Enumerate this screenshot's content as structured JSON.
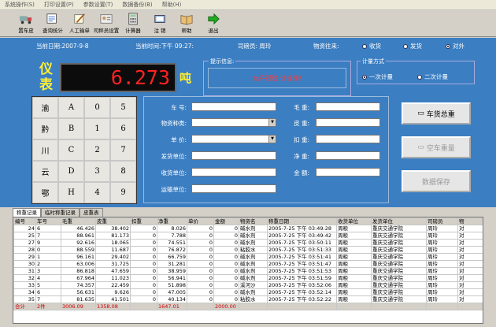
{
  "menu": [
    "系统操作(S)",
    "打印设置(P)",
    "参数设置(T)",
    "数据备份(B)",
    "帮助(H)"
  ],
  "toolbar": [
    {
      "label": "置车皮",
      "icon": "truck-icon"
    },
    {
      "label": "查询统计",
      "icon": "search-stats-icon"
    },
    {
      "label": "人工输单",
      "icon": "manual-entry-icon"
    },
    {
      "label": "司秤员设置",
      "icon": "operator-icon"
    },
    {
      "label": "计算器",
      "icon": "calculator-icon"
    },
    {
      "label": "注 销",
      "icon": "logout-icon"
    },
    {
      "label": "帮助",
      "icon": "help-book-icon"
    },
    {
      "label": "退出",
      "icon": "exit-arrow-icon"
    }
  ],
  "status": {
    "date": "当前日期:2007-9-8",
    "time": "当前时间:下午 09:27:",
    "operator": "司磅员: 周玲",
    "direction_label": "物资往来:",
    "options": [
      "收货",
      "发货",
      "对外"
    ],
    "selected": 2
  },
  "meter": {
    "label": "仪表",
    "value": "6.273",
    "unit": "吨"
  },
  "hint": {
    "title": "提示信息:",
    "text": "允许过磅,请操作!"
  },
  "calc": {
    "title": "计量方式",
    "options": [
      "一次计量",
      "二次计量"
    ],
    "selected": 0
  },
  "keypad": [
    "渝",
    "A",
    "0",
    "5",
    "黔",
    "B",
    "1",
    "6",
    "川",
    "C",
    "2",
    "7",
    "云",
    "D",
    "3",
    "8",
    "鄂",
    "H",
    "4",
    "9"
  ],
  "form_left": [
    {
      "label": "车 号:",
      "dropdown": false
    },
    {
      "label": "物资种类:",
      "dropdown": true
    },
    {
      "label": "单 价:",
      "dropdown": true
    },
    {
      "label": "发货单位:",
      "dropdown": false
    },
    {
      "label": "收货单位:",
      "dropdown": false
    },
    {
      "label": "运输单位:",
      "dropdown": false
    }
  ],
  "form_right": [
    "毛 重:",
    "皮 重:",
    "扣 重:",
    "净 重:",
    "金 额:"
  ],
  "buttons": [
    {
      "label": "车货总重",
      "enabled": true
    },
    {
      "label": "空车重量",
      "enabled": false
    },
    {
      "label": "数据保存",
      "enabled": false
    }
  ],
  "tabs": [
    "称重记录",
    "临时称重记录",
    "皮重表"
  ],
  "grid": {
    "headers": [
      "编号",
      "车号",
      "毛重",
      "皮重",
      "扣重",
      "净重",
      "单价",
      "金额",
      "物资名",
      "称重日期",
      "收货单位",
      "发货单位",
      "司磅员",
      "物"
    ],
    "rows": [
      [
        "24",
        "6",
        "46.426",
        "38.402",
        "0",
        "8.026",
        "0",
        "0",
        "碱水剂",
        "2005-7-25 下午 03:49:28",
        "周粮",
        "重庆交通学院",
        "周玲",
        "对"
      ],
      [
        "25",
        "7",
        "88.961",
        "81.173",
        "0",
        "7.788",
        "0",
        "0",
        "碱水剂",
        "2005-7-25 下午 03:49:42",
        "周粮",
        "重庆交通学院",
        "周玲",
        "对"
      ],
      [
        "27",
        "9",
        "92.616",
        "18.065",
        "0",
        "74.551",
        "0",
        "0",
        "碱水剂",
        "2005-7-25 下午 03:50:11",
        "周粮",
        "重庆交通学院",
        "周玲",
        "对"
      ],
      [
        "28",
        "0",
        "88.559",
        "11.687",
        "0",
        "76.872",
        "0",
        "0",
        "粘胶水",
        "2005-7-25 下午 03:51:33",
        "周粮",
        "重庆交通学院",
        "周玲",
        "对"
      ],
      [
        "29",
        "1",
        "96.161",
        "29.402",
        "0",
        "66.759",
        "0",
        "0",
        "碱水剂",
        "2005-7-25 下午 03:51:41",
        "周粮",
        "重庆交通学院",
        "周玲",
        "对"
      ],
      [
        "30",
        "2",
        "63.006",
        "31.725",
        "0",
        "31.281",
        "0",
        "0",
        "碱水剂",
        "2005-7-25 下午 03:51:47",
        "周粮",
        "重庆交通学院",
        "周玲",
        "对"
      ],
      [
        "31",
        "3",
        "86.818",
        "47.659",
        "0",
        "38.959",
        "0",
        "0",
        "碱水剂",
        "2005-7-25 下午 03:51:53",
        "周粮",
        "重庆交通学院",
        "周玲",
        "对"
      ],
      [
        "32",
        "4",
        "67.964",
        "11.023",
        "0",
        "56.941",
        "0",
        "0",
        "碱水剂",
        "2005-7-25 下午 03:51:59",
        "周粮",
        "重庆交通学院",
        "周玲",
        "对"
      ],
      [
        "33",
        "5",
        "74.357",
        "22.459",
        "0",
        "51.898",
        "0",
        "0",
        "溪河沙",
        "2005-7-25 下午 03:52:06",
        "周粮",
        "重庆交通学院",
        "周玲",
        "对"
      ],
      [
        "34",
        "6",
        "56.631",
        "9.626",
        "0",
        "47.005",
        "0",
        "0",
        "碱水剂",
        "2005-7-25 下午 03:52:14",
        "周粮",
        "重庆交通学院",
        "周玲",
        "对"
      ],
      [
        "35",
        "7",
        "81.635",
        "41.501",
        "0",
        "40.134",
        "0",
        "0",
        "粘胶水",
        "2005-7-25 下午 03:52:22",
        "周粮",
        "重庆交通学院",
        "周玲",
        "对"
      ]
    ],
    "summary": [
      "合计",
      "2件",
      "3006.09",
      "1358.08",
      "",
      "1647.01",
      "",
      "2000.00",
      "",
      "",
      "",
      "",
      "",
      ""
    ]
  }
}
